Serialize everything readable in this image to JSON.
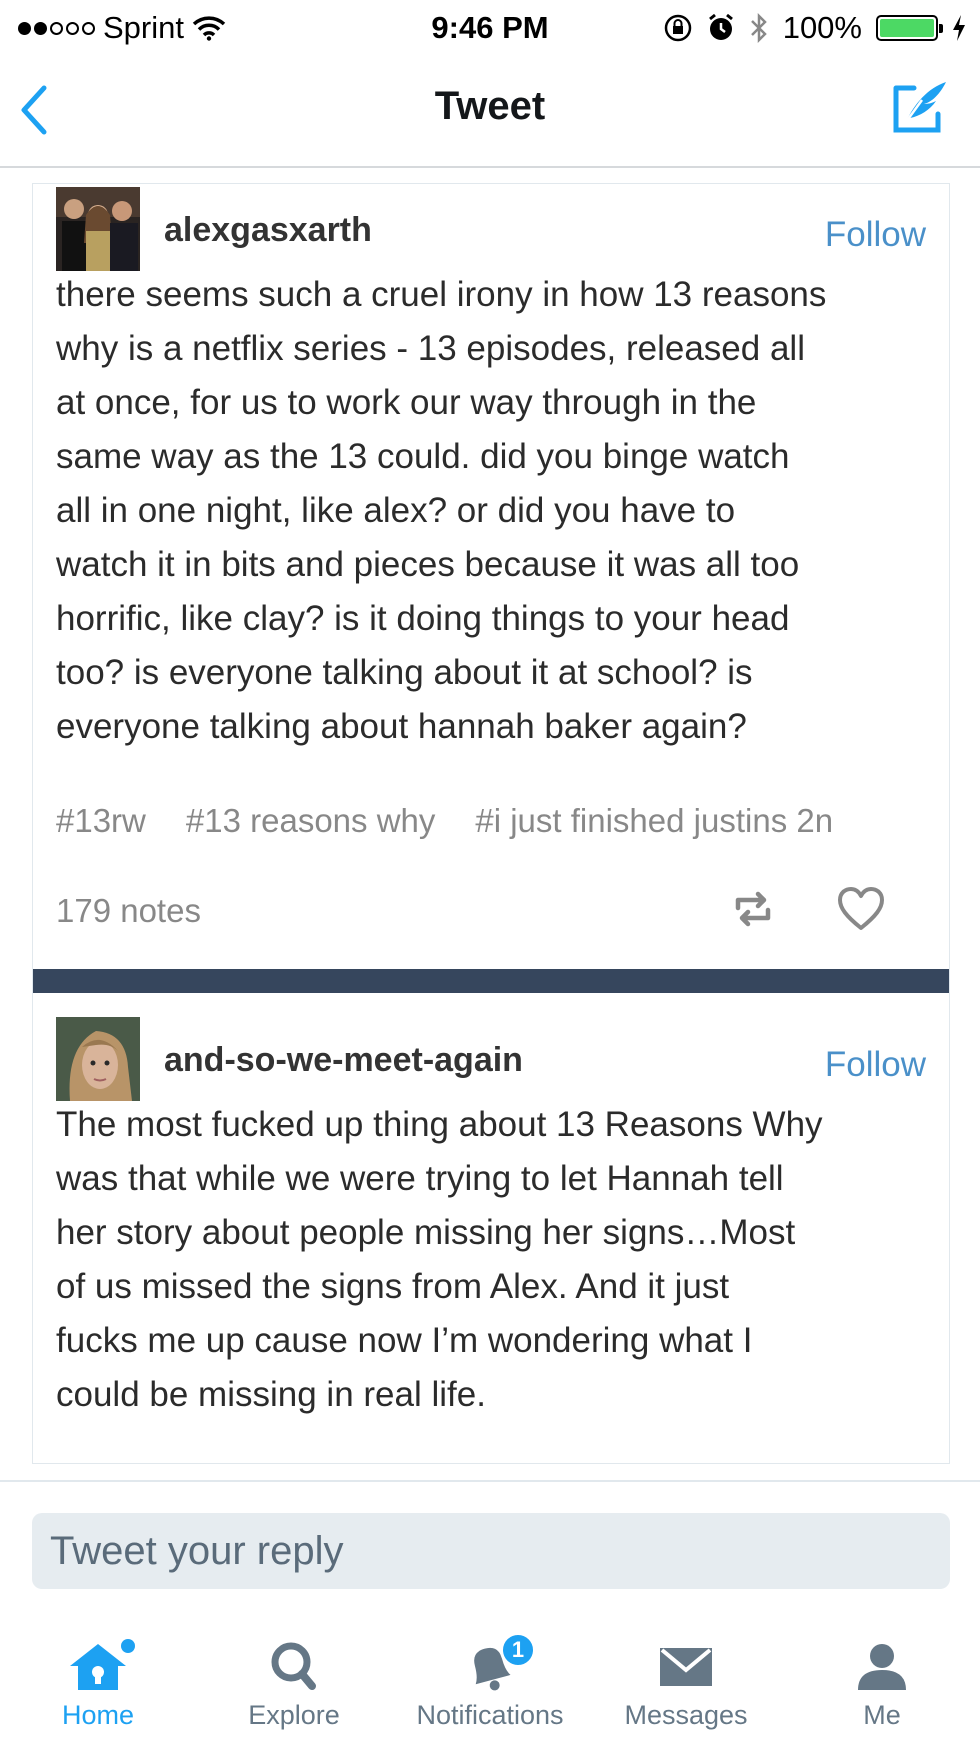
{
  "status_bar": {
    "carrier": "Sprint",
    "time": "9:46 PM",
    "battery_percent": "100%",
    "battery_level": 1.0
  },
  "nav": {
    "title": "Tweet",
    "back_icon": "chevron-left-icon",
    "compose_icon": "compose-icon"
  },
  "posts": [
    {
      "username": "alexgasxarth",
      "follow_label": "Follow",
      "body": [
        "there seems such a cruel irony in how 13 reasons",
        "why is a netflix series - 13 episodes, released all",
        "at once, for us to work our way through in the",
        "same way as the 13 could. did you binge watch",
        "all in one night, like alex? or did you have to",
        "watch it in bits and pieces because it was all too",
        "horrific, like clay? is it doing things to your head",
        "too? is everyone talking about it at school? is",
        "everyone talking about hannah baker again?"
      ],
      "tags": [
        "#13rw",
        "#13 reasons why",
        "#i just finished justins 2n"
      ],
      "notes": "179 notes"
    },
    {
      "username": "and-so-we-meet-again",
      "follow_label": "Follow",
      "body": [
        "The most fucked up thing about 13 Reasons Why",
        "was that while we were trying to let Hannah tell",
        "her story about people missing her signs…Most",
        "of us missed the signs from Alex. And it just",
        "fucks me up cause now I’m wondering what I",
        "could be missing in real life."
      ]
    }
  ],
  "reply": {
    "placeholder": "Tweet your reply"
  },
  "tabs": [
    {
      "label": "Home",
      "icon": "home-icon",
      "active": true
    },
    {
      "label": "Explore",
      "icon": "search-icon",
      "active": false
    },
    {
      "label": "Notifications",
      "icon": "bell-icon",
      "active": false,
      "badge": "1"
    },
    {
      "label": "Messages",
      "icon": "envelope-icon",
      "active": false
    },
    {
      "label": "Me",
      "icon": "person-icon",
      "active": false
    }
  ],
  "colors": {
    "accent": "#1da1f2",
    "follow": "#4a90c9",
    "divider_band": "#36465d",
    "battery": "#4cd964"
  }
}
